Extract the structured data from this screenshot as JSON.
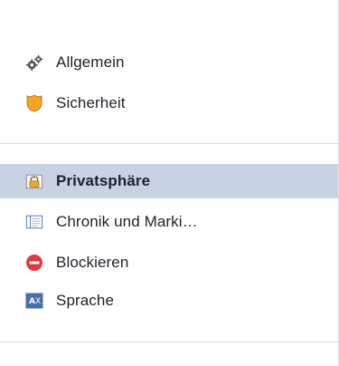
{
  "menu": {
    "group1": [
      {
        "label": "Allgemein",
        "icon": "gears-icon"
      },
      {
        "label": "Sicherheit",
        "icon": "shield-icon"
      }
    ],
    "group2": [
      {
        "label": "Privatsphäre",
        "icon": "padlock-icon",
        "active": true
      },
      {
        "label": "Chronik und Marki…",
        "icon": "timeline-icon"
      },
      {
        "label": "Blockieren",
        "icon": "block-icon"
      },
      {
        "label": "Sprache",
        "icon": "language-icon"
      }
    ]
  },
  "colors": {
    "active_bg": "#c7d2e5",
    "block_red": "#e0393e",
    "shield_orange": "#f2a52b",
    "language_blue": "#4a6ea9"
  }
}
